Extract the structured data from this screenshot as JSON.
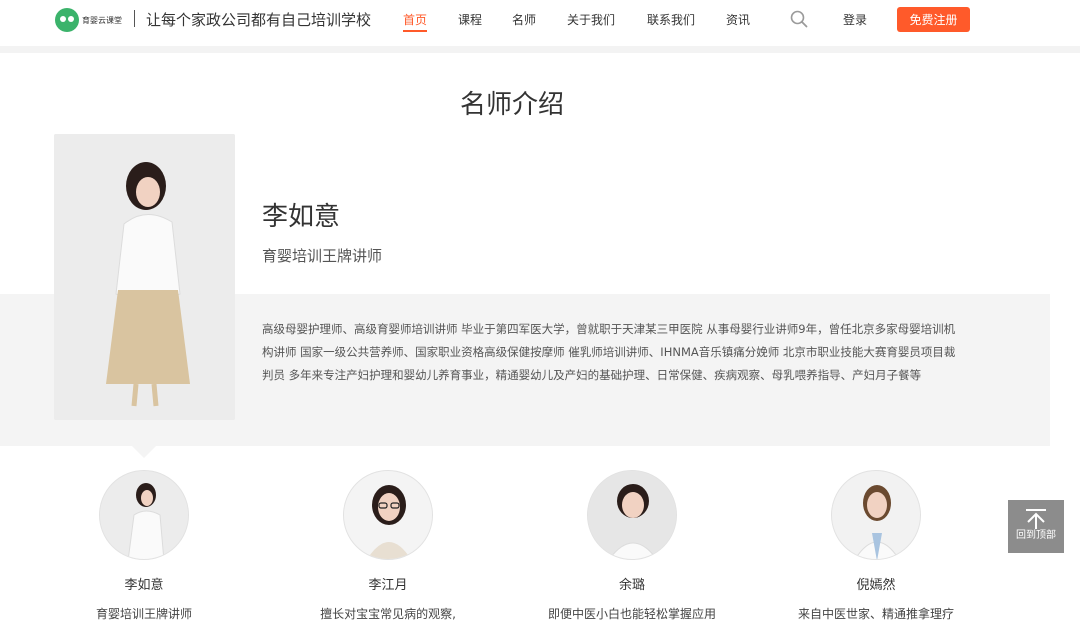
{
  "header": {
    "logo_text": "育婴云课堂",
    "slogan": "让每个家政公司都有自己培训学校",
    "nav": [
      {
        "label": "首页",
        "active": true
      },
      {
        "label": "课程",
        "active": false
      },
      {
        "label": "名师",
        "active": false
      },
      {
        "label": "关于我们",
        "active": false
      },
      {
        "label": "联系我们",
        "active": false
      },
      {
        "label": "资讯",
        "active": false
      }
    ],
    "login_label": "登录",
    "register_label": "免费注册",
    "accent_color": "#ff5a2a"
  },
  "section": {
    "title": "名师介绍"
  },
  "featured": {
    "name": "李如意",
    "title": "育婴培训王牌讲师",
    "description": "高级母婴护理师、高级育婴师培训讲师 毕业于第四军医大学，曾就职于天津某三甲医院 从事母婴行业讲师9年，曾任北京多家母婴培训机构讲师 国家一级公共营养师、国家职业资格高级保健按摩师 催乳师培训讲师、IHNMA音乐镇痛分娩师 北京市职业技能大赛育婴员项目裁判员 多年来专注产妇护理和婴幼儿养育事业，精通婴幼儿及产妇的基础护理、日常保健、疾病观察、母乳喂养指导、产妇月子餐等"
  },
  "teachers": [
    {
      "name": "李如意",
      "desc": "育婴培训王牌讲师"
    },
    {
      "name": "李江月",
      "desc": "擅长对宝宝常见病的观察,"
    },
    {
      "name": "余璐",
      "desc": "即便中医小白也能轻松掌握应用"
    },
    {
      "name": "倪嫣然",
      "desc": "来自中医世家、精通推拿理疗"
    }
  ],
  "back_to_top": {
    "label": "回到顶部"
  }
}
